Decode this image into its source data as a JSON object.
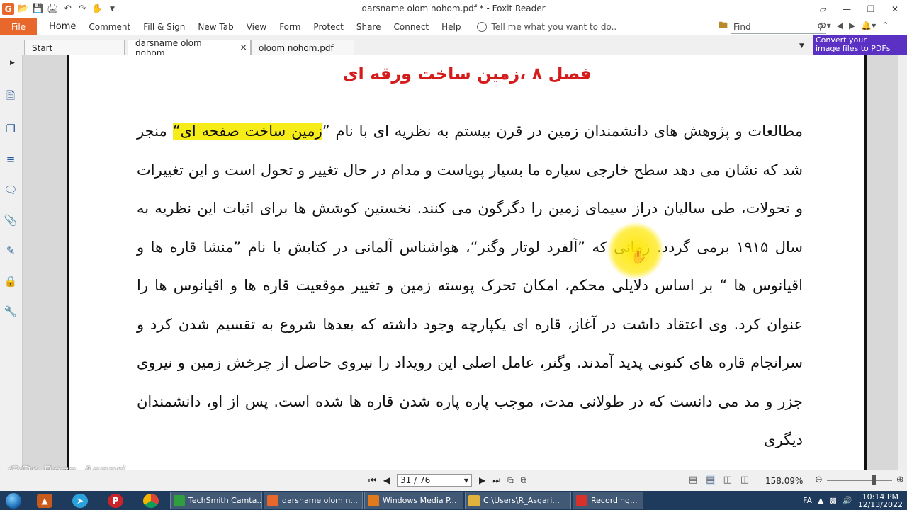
{
  "window": {
    "title": "darsname olom nohom.pdf * - Foxit Reader",
    "logo_letter": "G"
  },
  "quick_access": {
    "icons": [
      "open-folder-icon",
      "save-icon",
      "print-icon",
      "undo-icon",
      "redo-icon",
      "hand-tool-icon",
      "customize-dropdown-icon"
    ]
  },
  "ribbon": {
    "file_label": "File",
    "tabs": [
      "Home",
      "Comment",
      "Fill & Sign",
      "New Tab",
      "View",
      "Form",
      "Protect",
      "Share",
      "Connect",
      "Help"
    ],
    "tell_me": "Tell me what you want to do..",
    "find_placeholder": "Find"
  },
  "document_tabs": [
    {
      "label": "Start"
    },
    {
      "label": "darsname olom nohom....",
      "close": "×"
    },
    {
      "label": "oloom nohom.pdf"
    }
  ],
  "promo": {
    "line1": "Convert your",
    "line2": "image files to PDFs"
  },
  "page": {
    "chapter_title": "فصل ۸ ،زمین ساخت ورقه ای",
    "para_before": "مطالعات و پژوهش های دانشمندان زمین در قرن بیستم به نظریه ای با نام ”",
    "para_highlight": "زمین ساخت صفحه ای“",
    "para_after": " منجر شد که نشان می دهد سطح خارجی سیاره ما بسیار پویاست و مدام در حال تغییر و تحول است و این تغییرات و تحولات، طی سالیان دراز سیمای زمین را دگرگون می کنند. نخستین کوشش ها برای اثبات این نظریه به سال ۱۹۱۵ برمی گردد. زمانی که ”آلفرد لوتار وگنر“، هواشناس آلمانی در کتابش با نام ”منشا قاره ها و اقیانوس ها “ بر اساس دلایلی محکم، امکان تحرک پوسته زمین و تغییر موقعیت قاره ها و اقیانوس ها را عنوان کرد. وی اعتقاد داشت در آغاز، قاره ای یکپارچه وجود داشته که بعدها شروع به تقسیم شدن کرد و سرانجام قاره های کنونی پدید آمدند. وگنر، عامل اصلی این رویداد را نیروی حاصل از چرخش زمین و نیروی جزر و مد می دانست که در طولانی مدت، موجب پاره پاره شدن قاره ها شده است. پس از او، دانشمندان دیگری"
  },
  "watermark": "@Dr_Reza_Asgari",
  "status": {
    "page_indicator": "31 / 76",
    "zoom": "158.09%"
  },
  "taskbar": {
    "tasks": [
      {
        "label": "TechSmith Camta...",
        "color": "#2e9e3e"
      },
      {
        "label": "darsname olom n...",
        "color": "#e8672a"
      },
      {
        "label": "Windows Media P...",
        "color": "#e07a1c"
      },
      {
        "label": "C:\\Users\\R_Asgari...",
        "color": "#e2b33c"
      },
      {
        "label": "Recording...",
        "color": "#d8302b"
      }
    ],
    "lang": "FA",
    "time": "10:14 PM",
    "date": "12/13/2022"
  }
}
